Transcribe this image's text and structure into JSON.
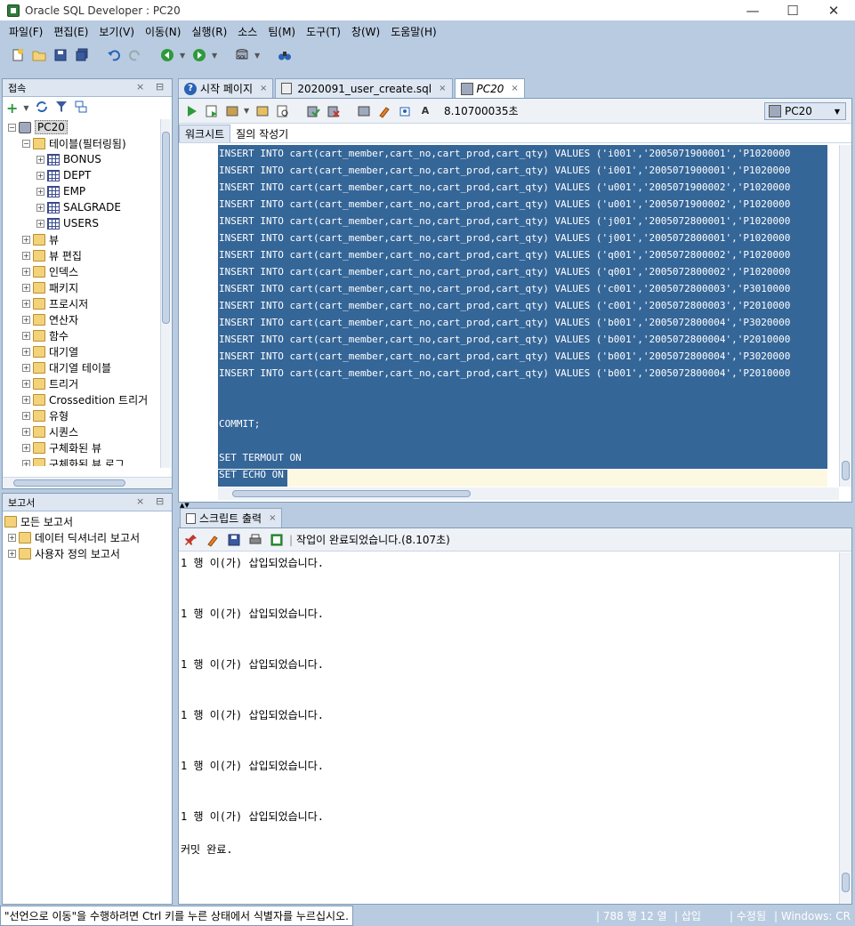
{
  "window": {
    "title": "Oracle SQL Developer : PC20",
    "minimize": "—",
    "maximize": "☐",
    "close": "✕"
  },
  "menu": [
    "파일(F)",
    "편집(E)",
    "보기(V)",
    "이동(N)",
    "실행(R)",
    "소스",
    "팀(M)",
    "도구(T)",
    "창(W)",
    "도움말(H)"
  ],
  "connections": {
    "title": "접속",
    "tree": [
      {
        "label": "PC20",
        "indent": 0,
        "icon": "db",
        "toggle": "−",
        "selected": true
      },
      {
        "label": "테이블(필터링됨)",
        "indent": 1,
        "icon": "folder",
        "toggle": "−"
      },
      {
        "label": "BONUS",
        "indent": 2,
        "icon": "table",
        "toggle": "+"
      },
      {
        "label": "DEPT",
        "indent": 2,
        "icon": "table",
        "toggle": "+"
      },
      {
        "label": "EMP",
        "indent": 2,
        "icon": "table",
        "toggle": "+"
      },
      {
        "label": "SALGRADE",
        "indent": 2,
        "icon": "table",
        "toggle": "+"
      },
      {
        "label": "USERS",
        "indent": 2,
        "icon": "table",
        "toggle": "+"
      },
      {
        "label": "뷰",
        "indent": 1,
        "icon": "folder",
        "toggle": "+"
      },
      {
        "label": "뷰 편집",
        "indent": 1,
        "icon": "folder",
        "toggle": "+"
      },
      {
        "label": "인덱스",
        "indent": 1,
        "icon": "folder",
        "toggle": "+"
      },
      {
        "label": "패키지",
        "indent": 1,
        "icon": "folder",
        "toggle": "+"
      },
      {
        "label": "프로시저",
        "indent": 1,
        "icon": "folder",
        "toggle": "+"
      },
      {
        "label": "연산자",
        "indent": 1,
        "icon": "folder",
        "toggle": "+"
      },
      {
        "label": "함수",
        "indent": 1,
        "icon": "folder",
        "toggle": "+"
      },
      {
        "label": "대기열",
        "indent": 1,
        "icon": "folder",
        "toggle": "+"
      },
      {
        "label": "대기열 테이블",
        "indent": 1,
        "icon": "folder",
        "toggle": "+"
      },
      {
        "label": "트리거",
        "indent": 1,
        "icon": "folder",
        "toggle": "+"
      },
      {
        "label": "Crossedition 트리거",
        "indent": 1,
        "icon": "folder",
        "toggle": "+"
      },
      {
        "label": "유형",
        "indent": 1,
        "icon": "folder",
        "toggle": "+"
      },
      {
        "label": "시퀀스",
        "indent": 1,
        "icon": "folder",
        "toggle": "+"
      },
      {
        "label": "구체화된 뷰",
        "indent": 1,
        "icon": "folder",
        "toggle": "+"
      },
      {
        "label": "구체화된 뷰 로그",
        "indent": 1,
        "icon": "folder",
        "toggle": "+"
      }
    ]
  },
  "reports": {
    "title": "보고서",
    "tree": [
      {
        "label": "모든 보고서",
        "indent": 0,
        "toggle": ""
      },
      {
        "label": "데이터 딕셔너리 보고서",
        "indent": 1,
        "toggle": "+"
      },
      {
        "label": "사용자 정의 보고서",
        "indent": 1,
        "toggle": "+"
      }
    ]
  },
  "editor": {
    "tabs": [
      {
        "label": "시작 페이지",
        "icon": "help"
      },
      {
        "label": "2020091_user_create.sql",
        "icon": "file"
      },
      {
        "label": "PC20",
        "icon": "sql",
        "active": true
      }
    ],
    "exec_time": "8.10700035초",
    "connection": "PC20",
    "subtabs": [
      "워크시트",
      "질의 작성기"
    ],
    "code_lines": [
      "INSERT INTO cart(cart_member,cart_no,cart_prod,cart_qty) VALUES ('i001','2005071900001','P1020000",
      "INSERT INTO cart(cart_member,cart_no,cart_prod,cart_qty) VALUES ('i001','2005071900001','P1020000",
      "INSERT INTO cart(cart_member,cart_no,cart_prod,cart_qty) VALUES ('u001','2005071900002','P1020000",
      "INSERT INTO cart(cart_member,cart_no,cart_prod,cart_qty) VALUES ('u001','2005071900002','P1020000",
      "INSERT INTO cart(cart_member,cart_no,cart_prod,cart_qty) VALUES ('j001','2005072800001','P1020000",
      "INSERT INTO cart(cart_member,cart_no,cart_prod,cart_qty) VALUES ('j001','2005072800001','P1020000",
      "INSERT INTO cart(cart_member,cart_no,cart_prod,cart_qty) VALUES ('q001','2005072800002','P1020000",
      "INSERT INTO cart(cart_member,cart_no,cart_prod,cart_qty) VALUES ('q001','2005072800002','P1020000",
      "INSERT INTO cart(cart_member,cart_no,cart_prod,cart_qty) VALUES ('c001','2005072800003','P3010000",
      "INSERT INTO cart(cart_member,cart_no,cart_prod,cart_qty) VALUES ('c001','2005072800003','P2010000",
      "INSERT INTO cart(cart_member,cart_no,cart_prod,cart_qty) VALUES ('b001','2005072800004','P3020000",
      "INSERT INTO cart(cart_member,cart_no,cart_prod,cart_qty) VALUES ('b001','2005072800004','P2010000",
      "INSERT INTO cart(cart_member,cart_no,cart_prod,cart_qty) VALUES ('b001','2005072800004','P3020000",
      "INSERT INTO cart(cart_member,cart_no,cart_prod,cart_qty) VALUES ('b001','2005072800004','P2010000",
      "",
      "",
      "COMMIT;",
      "",
      "SET TERMOUT ON",
      "SET ECHO ON"
    ]
  },
  "output": {
    "tab_label": "스크립트 출력",
    "status": "작업이 완료되었습니다.(8.107초)",
    "lines": [
      {
        "text": "1 행 이(가) 삽입되었습니다.",
        "row": 0
      },
      {
        "text": "1 행 이(가) 삽입되었습니다.",
        "row": 1
      },
      {
        "text": "1 행 이(가) 삽입되었습니다.",
        "row": 2
      },
      {
        "text": "1 행 이(가) 삽입되었습니다.",
        "row": 3
      },
      {
        "text": "1 행 이(가) 삽입되었습니다.",
        "row": 4
      },
      {
        "text": "1 행 이(가) 삽입되었습니다.",
        "row": 5
      },
      {
        "text": "커밋 완료.",
        "row": 6
      }
    ]
  },
  "statusbar": {
    "message": "\"선언으로 이동\"을 수행하려면 Ctrl 키를 누른 상태에서 식별자를 누르십시오.",
    "position": "788 행 12 열",
    "mode": "삽입",
    "modified": "수정됨",
    "platform": "Windows: CR"
  }
}
